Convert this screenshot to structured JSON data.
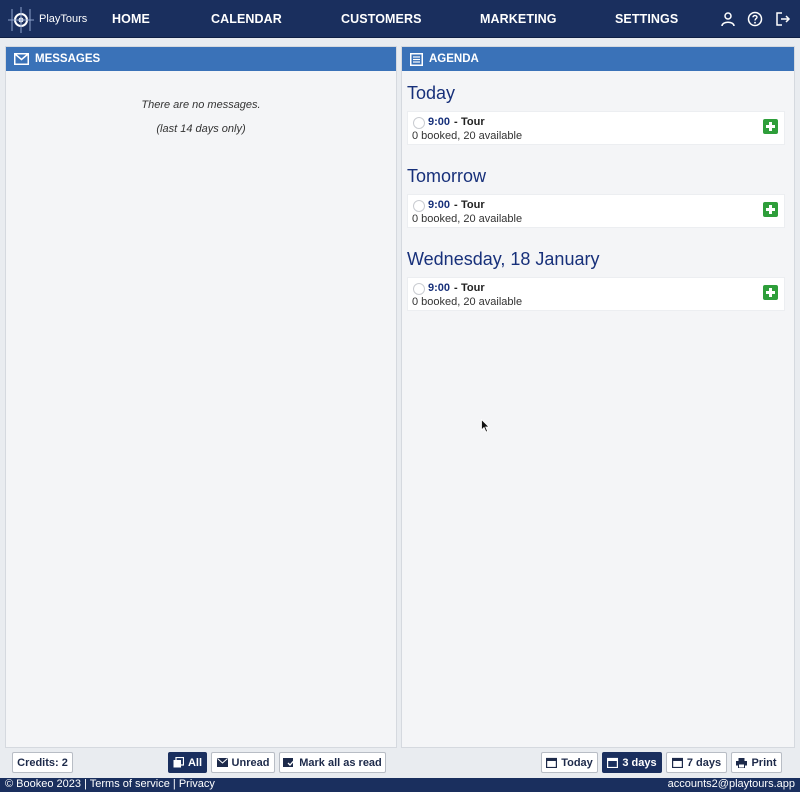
{
  "app": {
    "brand": "PlayTours"
  },
  "nav": {
    "items": [
      "HOME",
      "CALENDAR",
      "CUSTOMERS",
      "MARKETING",
      "SETTINGS"
    ],
    "icons": [
      "user-icon",
      "help-icon",
      "logout-icon"
    ]
  },
  "messages": {
    "title": "MESSAGES",
    "empty_text": "There are no messages.",
    "note": "(last 14 days only)"
  },
  "agenda": {
    "title": "AGENDA",
    "days": [
      {
        "heading": "Today",
        "slot": {
          "time": "9:00",
          "separator": "-",
          "name": "Tour",
          "status": "0 booked, 20 available"
        }
      },
      {
        "heading": "Tomorrow",
        "slot": {
          "time": "9:00",
          "separator": "-",
          "name": "Tour",
          "status": "0 booked, 20 available"
        }
      },
      {
        "heading": "Wednesday, 18 January",
        "slot": {
          "time": "9:00",
          "separator": "-",
          "name": "Tour",
          "status": "0 booked, 20 available"
        }
      }
    ]
  },
  "toolbar": {
    "credits": "Credits: 2",
    "all": "All",
    "unread": "Unread",
    "mark_all": "Mark all as read",
    "today": "Today",
    "three_days": "3 days",
    "seven_days": "7 days",
    "print": "Print"
  },
  "footer": {
    "copyright": "© Bookeo 2023",
    "sep1": "|",
    "terms": "Terms of service",
    "sep2": "|",
    "privacy": "Privacy",
    "account": "accounts2@playtours.app"
  },
  "colors": {
    "nav_bg": "#1a2f5e",
    "panel_header": "#3a72b8",
    "add_button": "#2e9e3a",
    "heading": "#17307a"
  }
}
